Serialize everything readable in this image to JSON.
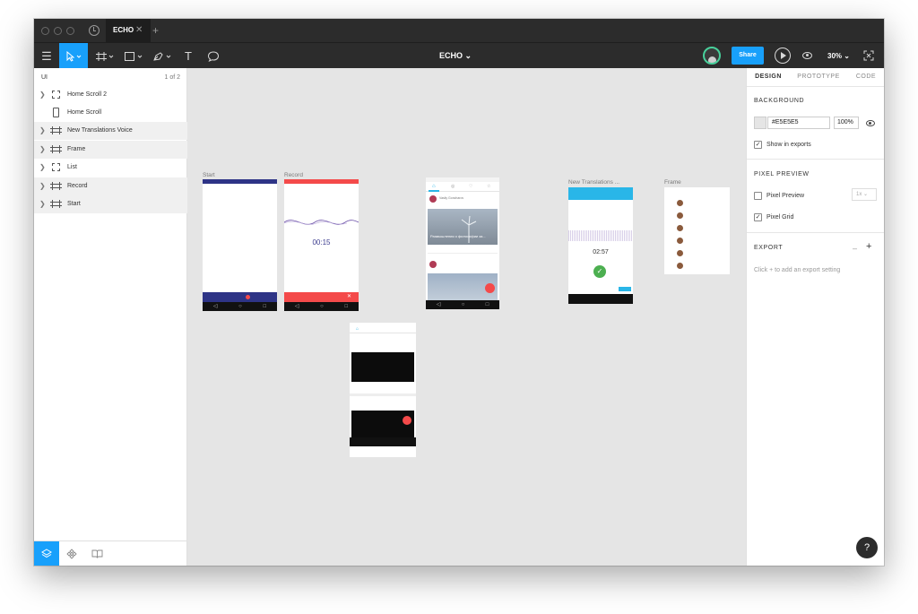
{
  "tabbar": {
    "file_tab": "ECHO",
    "close": "✕",
    "add": "+"
  },
  "toolbar": {
    "file_title": "ECHO ⌄",
    "share": "Share",
    "zoom": "30% ⌄"
  },
  "layers": {
    "page_name": "UI",
    "page_count": "1 of 2",
    "items": [
      {
        "label": "Home Scroll 2",
        "icon": "component-icon",
        "chevron": false
      },
      {
        "label": "Home Scroll",
        "icon": "phone-icon",
        "chevron": false
      },
      {
        "label": "New Translations Voice",
        "icon": "frame-icon",
        "chevron": true
      },
      {
        "label": "Frame",
        "icon": "frame-icon",
        "chevron": true
      },
      {
        "label": "List",
        "icon": "component-icon",
        "chevron": true
      },
      {
        "label": "Record",
        "icon": "frame-icon",
        "chevron": true
      },
      {
        "label": "Start",
        "icon": "frame-icon",
        "chevron": true
      }
    ]
  },
  "inspector": {
    "tabs": [
      "DESIGN",
      "PROTOTYPE",
      "CODE"
    ],
    "background_title": "BACKGROUND",
    "background_hex": "#E5E5E5",
    "background_opacity": "100%",
    "show_in_exports": "Show in exports",
    "pixel_preview_title": "PIXEL PREVIEW",
    "pixel_preview": "Pixel Preview",
    "pixel_grid": "Pixel Grid",
    "scale": "1x",
    "export_title": "EXPORT",
    "export_hint": "Click + to add an export setting",
    "help": "?"
  },
  "canvas": {
    "frames": {
      "start": "Start",
      "record": "Record",
      "new_translations": "New Translations ...",
      "frame": "Frame"
    },
    "record_timer": "00:15",
    "translation_timer": "02:57",
    "feed_caption": "Размышления о философии за...",
    "feed_author": "Vasily Goncharov"
  },
  "colors": {
    "accent": "#18a0fb",
    "chrome": "#2c2c2c",
    "canvas": "#e5e5e5",
    "record_red": "#f44a4a",
    "start_navy": "#2e3486",
    "cyan": "#29b6e8",
    "green": "#4caf50"
  }
}
